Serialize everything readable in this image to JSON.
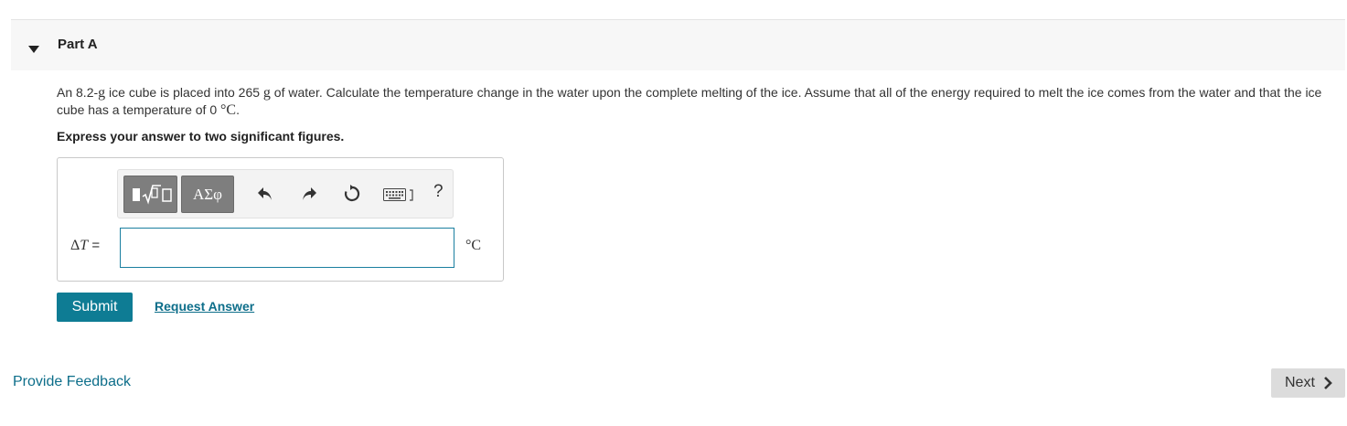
{
  "part": {
    "title": "Part A",
    "expanded": true
  },
  "question": {
    "text_1": "An 8.2-",
    "unit_g_1": "g",
    "text_2": " ice cube is placed into 265 ",
    "unit_g_2": "g",
    "text_3": " of water. Calculate the temperature change in the water upon the complete melting of the ice. Assume that all of the energy required to melt the ice comes from the water and that the ice cube has a temperature of 0 ",
    "unit_c": "°C",
    "text_4": "."
  },
  "instruction": "Express your answer to two significant figures.",
  "toolbar": {
    "templates_icon": "templates-icon",
    "greek_label": "ΑΣφ",
    "undo_icon": "undo-icon",
    "redo_icon": "redo-icon",
    "reset_icon": "reset-icon",
    "keyboard_icon": "keyboard-icon",
    "help_label": "?"
  },
  "answer": {
    "variable_symbol": "Δ",
    "variable_letter": "T",
    "equals": " =",
    "value": "",
    "unit": "°C"
  },
  "actions": {
    "submit_label": "Submit",
    "request_label": "Request Answer"
  },
  "footer": {
    "feedback_label": "Provide Feedback",
    "next_label": "Next"
  },
  "colors": {
    "accent": "#0e7c94",
    "link": "#0d6e8a",
    "input_border": "#1a7fa0",
    "toolbar_button": "#7e7e7e",
    "header_bg": "#f7f7f7"
  }
}
